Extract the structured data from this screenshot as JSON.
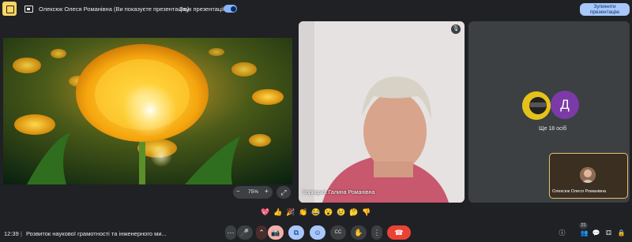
{
  "topbar": {
    "presenter_title": "Олексюк Олеся Романівна (Ви показуєте презентацію)",
    "sound_label": "Звук презентації",
    "sound_enabled": true,
    "stop_button": "Зупинити презентацію"
  },
  "stage": {
    "zoom_level": "75%"
  },
  "participants": {
    "main_name": "Корицька Галина Романівна",
    "avatar_letter": "Д",
    "more_label": "Ще 18 осіб",
    "self_name": "Олексюк Олеся Романівна"
  },
  "reactions": [
    "💖",
    "👍",
    "🎉",
    "👏",
    "😂",
    "😮",
    "😢",
    "🤔",
    "👎"
  ],
  "bottombar": {
    "time": "12:39",
    "separator": "|",
    "meeting_title": "Розвиток наукової грамотності та інженерного ми...",
    "participant_count": "21"
  },
  "icons": {
    "more_options": "⋯",
    "mic": "🎤",
    "chevron_up": "⌃",
    "camera_off": "📷",
    "present": "⧉",
    "emoji": "☺",
    "captions": "CC",
    "hand": "✋",
    "more_vert": "⋮",
    "end_call": "☎",
    "info": "ⓘ",
    "people": "👥",
    "chat": "💬",
    "activities": "⚃",
    "lock": "🔒",
    "zoom_out": "−",
    "zoom_in": "+",
    "expand": "⤢"
  },
  "colors": {
    "background": "#202124",
    "accent": "#a8c7fa",
    "end_call": "#ea4335",
    "present_active": "#8ab4f8",
    "camera_off_bg": "#f6aea9"
  }
}
